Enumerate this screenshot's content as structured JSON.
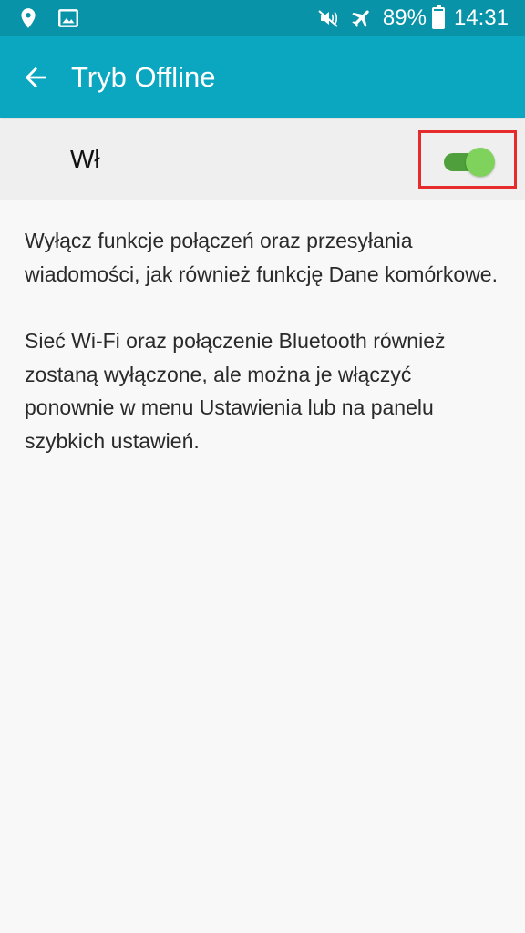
{
  "status_bar": {
    "battery": "89%",
    "time": "14:31",
    "icons": {
      "left": [
        "location-icon",
        "image-icon"
      ],
      "right": [
        "mute-icon",
        "airplane-icon",
        "battery-icon"
      ]
    },
    "battery_level": 0.89
  },
  "app_bar": {
    "title": "Tryb Offline",
    "back_icon": "back-arrow-icon"
  },
  "main_switch": {
    "label": "Wł",
    "state": "on"
  },
  "description": {
    "paragraph1": "Wyłącz funkcje połączeń oraz przesyłania wiadomości, jak również funkcję Dane komórkowe.",
    "paragraph2": "Sieć Wi-Fi oraz połączenie Bluetooth również zostaną wyłączone, ale można je włączyć ponownie w menu Ustawienia lub na panelu szybkich ustawień."
  },
  "colors": {
    "status_bar": "#0893a8",
    "app_bar": "#0ba7c1",
    "toggle_track": "#4fa03c",
    "toggle_thumb": "#7fd35c",
    "highlight": "#e52b2b"
  }
}
